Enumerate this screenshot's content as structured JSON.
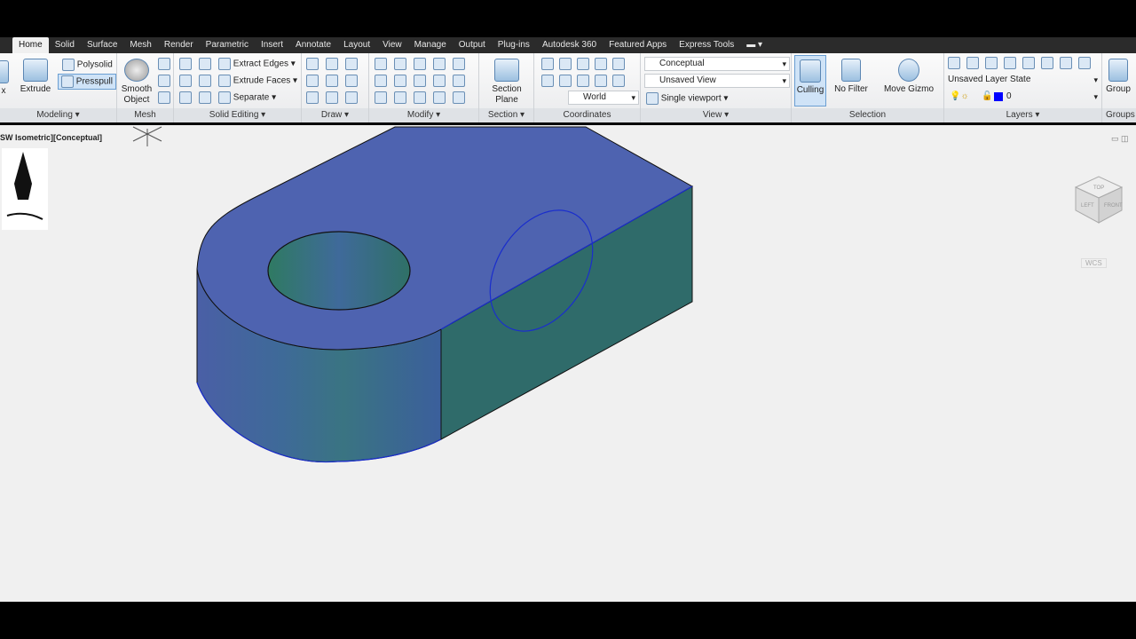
{
  "tabs": [
    "Home",
    "Solid",
    "Surface",
    "Mesh",
    "Render",
    "Parametric",
    "Insert",
    "Annotate",
    "Layout",
    "View",
    "Manage",
    "Output",
    "Plug-ins",
    "Autodesk 360",
    "Featured Apps",
    "Express Tools"
  ],
  "modeling": {
    "title": "Modeling ▾",
    "box": "x",
    "extrude": "Extrude",
    "polysolid": "Polysolid",
    "presspull": "Presspull"
  },
  "mesh": {
    "title": "Mesh",
    "smooth": "Smooth",
    "object": "Object"
  },
  "solid_editing": {
    "title": "Solid Editing ▾",
    "extract": "Extract Edges ▾",
    "extrude_faces": "Extrude Faces ▾",
    "separate": "Separate ▾"
  },
  "draw": {
    "title": "Draw ▾"
  },
  "modify": {
    "title": "Modify ▾"
  },
  "section": {
    "title": "Section ▾",
    "plane1": "Section",
    "plane2": "Plane"
  },
  "coordinates": {
    "title": "Coordinates",
    "world": "World"
  },
  "view": {
    "title": "View ▾",
    "visual_style": "Conceptual",
    "named_view": "Unsaved View",
    "viewport": "Single viewport ▾"
  },
  "selection": {
    "title": "Selection",
    "culling": "Culling",
    "no_filter": "No Filter",
    "move_gizmo": "Move Gizmo"
  },
  "layers": {
    "title": "Layers ▾",
    "layer_state": "Unsaved Layer State",
    "layer": "0",
    "layer_color": "#0000ff"
  },
  "groups": {
    "title": "Groups",
    "group": "Group"
  },
  "viewport": {
    "label": "SW Isometric][Conceptual]",
    "wcs": "WCS",
    "cube_top": "TOP",
    "cube_left": "LEFT",
    "cube_front": "FRONT"
  },
  "colors": {
    "top_face": "#4e63b0",
    "side_face": "#2f6b6a",
    "edge_highlight": "#1a2ecc"
  }
}
